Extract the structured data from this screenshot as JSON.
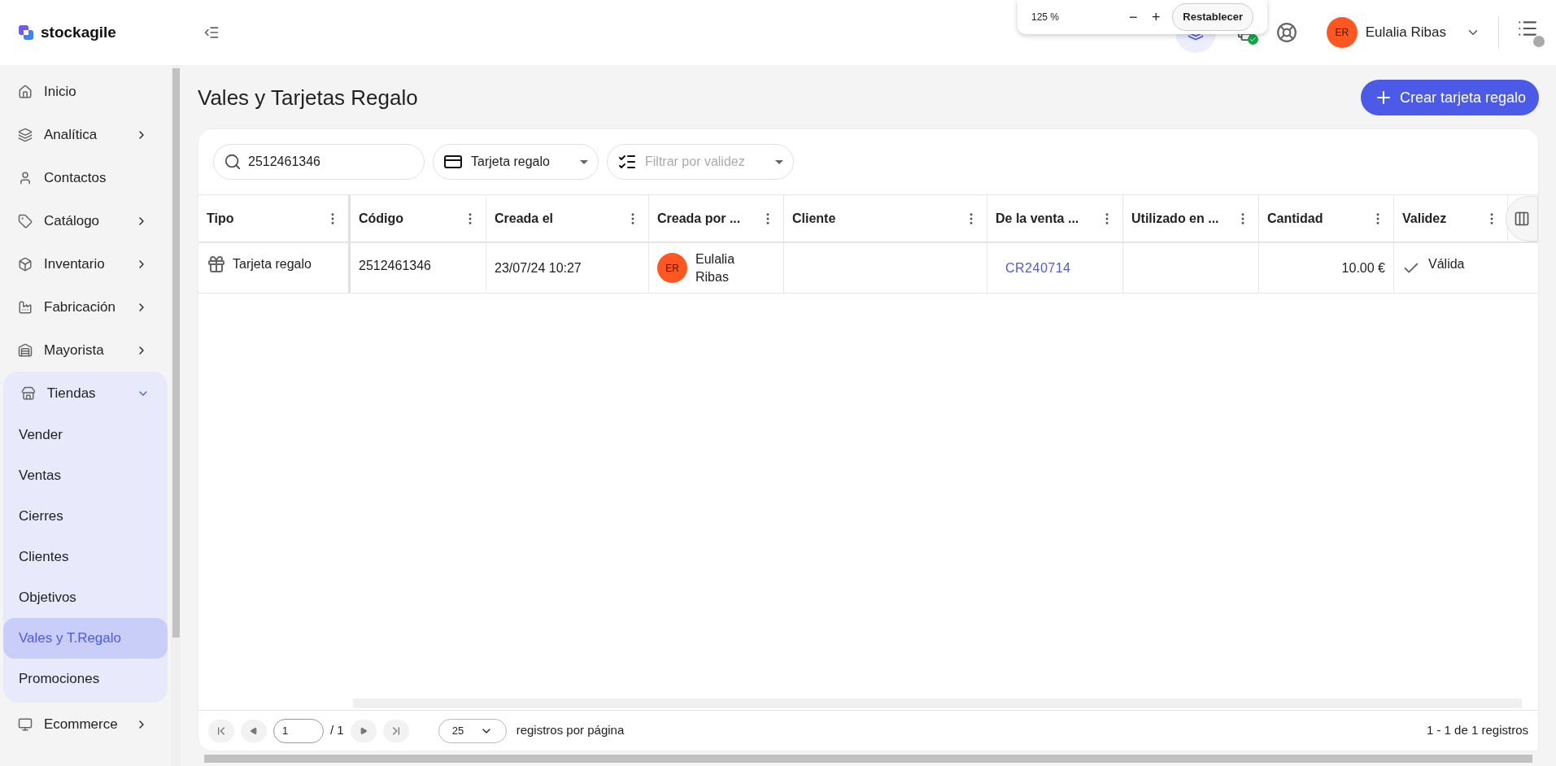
{
  "brand": "stockagile",
  "zoom_popup": {
    "value": "125 %",
    "decrease": "−",
    "increase": "+",
    "reset": "Restablecer"
  },
  "user": {
    "initials": "ER",
    "name": "Eulalia Ribas"
  },
  "sidebar": {
    "items": [
      {
        "label": "Inicio"
      },
      {
        "label": "Analítica",
        "expanded": false
      },
      {
        "label": "Contactos"
      },
      {
        "label": "Catálogo",
        "expanded": false
      },
      {
        "label": "Inventario",
        "expanded": false
      },
      {
        "label": "Fabricación",
        "expanded": false
      },
      {
        "label": "Mayorista",
        "expanded": false
      },
      {
        "label": "Tiendas",
        "expanded": true,
        "children": [
          {
            "label": "Vender",
            "selected": false
          },
          {
            "label": "Ventas",
            "selected": false
          },
          {
            "label": "Cierres",
            "selected": false
          },
          {
            "label": "Clientes",
            "selected": false
          },
          {
            "label": "Objetivos",
            "selected": false
          },
          {
            "label": "Vales y T.Regalo",
            "selected": true
          },
          {
            "label": "Promociones",
            "selected": false
          }
        ]
      },
      {
        "label": "Ecommerce",
        "expanded": false
      }
    ]
  },
  "page": {
    "title": "Vales y Tarjetas Regalo",
    "create_button": "Crear tarjeta regalo"
  },
  "filters": {
    "search": {
      "value": "2512461346"
    },
    "type_select": {
      "value": "Tarjeta regalo"
    },
    "validity_select": {
      "placeholder": "Filtrar por validez"
    }
  },
  "table": {
    "columns": [
      "Tipo",
      "Código",
      "Creada el",
      "Creada por ...",
      "Cliente",
      "De la venta ...",
      "Utilizado en ...",
      "Cantidad",
      "Validez"
    ],
    "rows": [
      {
        "tipo": "Tarjeta regalo",
        "codigo": "2512461346",
        "creada_el": "23/07/24 10:27",
        "creada_por": {
          "initials": "ER",
          "name": "Eulalia Ribas"
        },
        "de_la_venta": "CR240714",
        "cantidad": "10.00 €",
        "validez": "Válida",
        "valid": true
      }
    ]
  },
  "pagination": {
    "page": "1",
    "total_pages": "/ 1",
    "page_size": "25",
    "page_size_label": "registros por página",
    "summary": "1 - 1 de 1 registros"
  }
}
